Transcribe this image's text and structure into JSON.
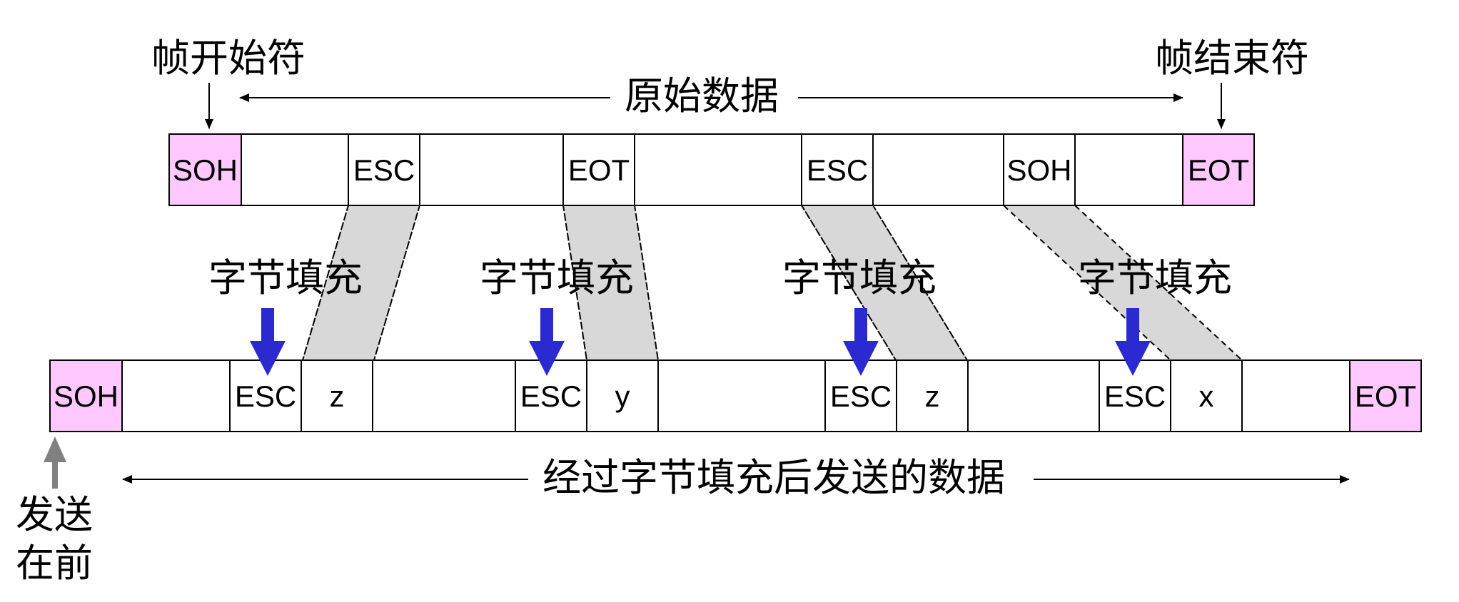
{
  "labels": {
    "frame_start": "帧开始符",
    "frame_end": "帧结束符",
    "original_data": "原始数据",
    "stuffed_data": "经过字节填充后发送的数据",
    "send_first_line1": "发送",
    "send_first_line2": "在前",
    "byte_stuffing": "字节填充"
  },
  "colors": {
    "delimiter_fill": "#ffc8ff",
    "stuff_arrow": "#2a2ad0",
    "send_arrow": "#808080",
    "shade": "#d8d8d8"
  },
  "original_frame": [
    {
      "text": "SOH",
      "delimiter": true
    },
    {
      "text": ""
    },
    {
      "text": "ESC"
    },
    {
      "text": ""
    },
    {
      "text": "EOT"
    },
    {
      "text": ""
    },
    {
      "text": "ESC"
    },
    {
      "text": ""
    },
    {
      "text": "SOH"
    },
    {
      "text": ""
    },
    {
      "text": "EOT",
      "delimiter": true
    }
  ],
  "stuffed_frame": [
    {
      "text": "SOH",
      "delimiter": true
    },
    {
      "text": ""
    },
    {
      "text": "ESC",
      "inserted": true
    },
    {
      "text": "z"
    },
    {
      "text": ""
    },
    {
      "text": "ESC",
      "inserted": true
    },
    {
      "text": "y"
    },
    {
      "text": ""
    },
    {
      "text": "ESC",
      "inserted": true
    },
    {
      "text": "z"
    },
    {
      "text": ""
    },
    {
      "text": "ESC",
      "inserted": true
    },
    {
      "text": "x"
    },
    {
      "text": ""
    },
    {
      "text": "EOT",
      "delimiter": true
    }
  ],
  "stuffing_points": 4
}
